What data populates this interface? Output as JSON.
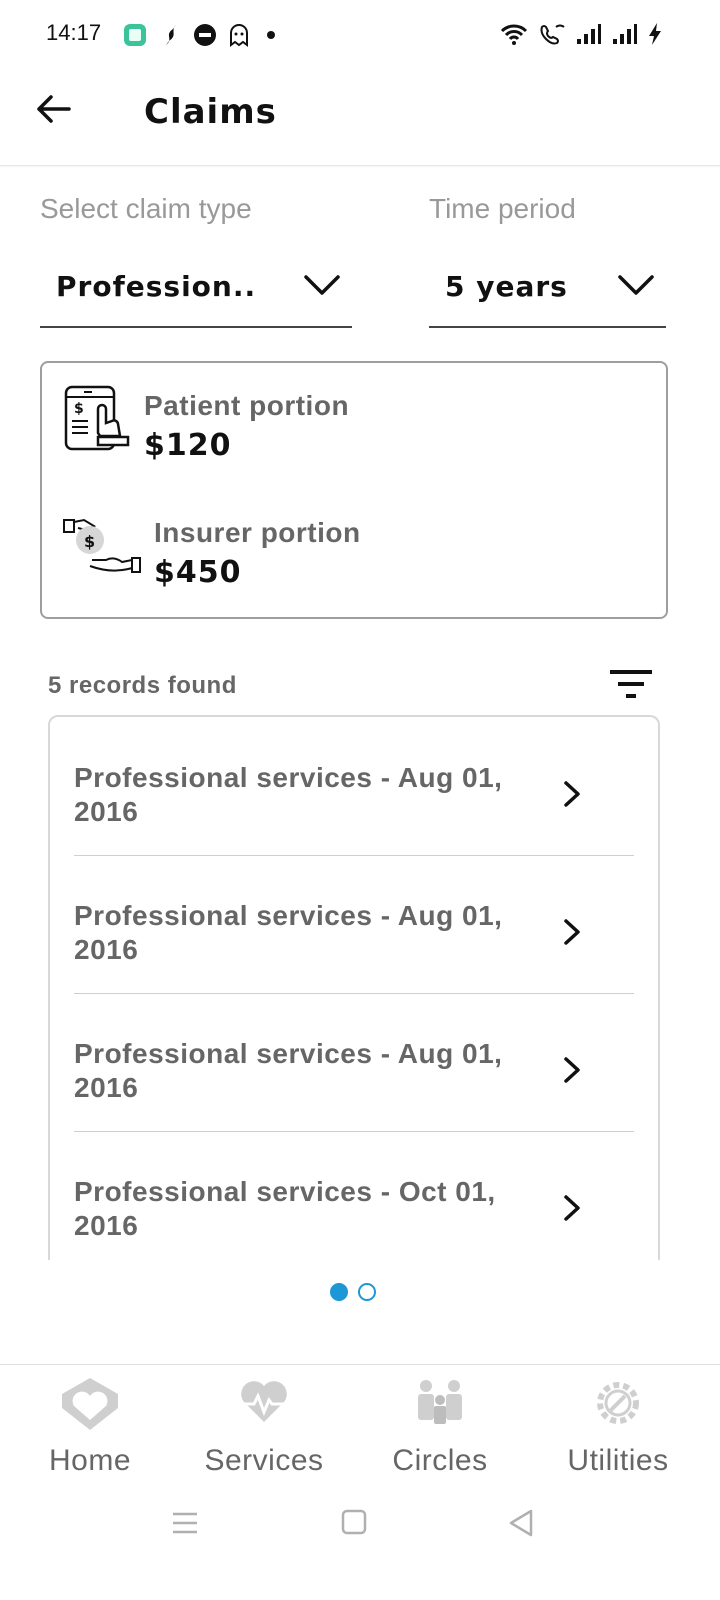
{
  "status_bar": {
    "time": "14:17"
  },
  "header": {
    "title": "Claims"
  },
  "filters": {
    "claim_type_label": "Select claim type",
    "claim_type_value": "Profession..",
    "time_period_label": "Time period",
    "time_period_value": "5 years"
  },
  "summary": {
    "patient_label": "Patient portion",
    "patient_amount": "$120",
    "insurer_label": "Insurer portion",
    "insurer_amount": "$450"
  },
  "records": {
    "count_text": "5 records found",
    "items": [
      {
        "title": "Professional services - Aug 01, 2016"
      },
      {
        "title": "Professional services - Aug 01, 2016"
      },
      {
        "title": "Professional services - Aug 01, 2016"
      },
      {
        "title": "Professional services - Oct 01, 2016"
      }
    ]
  },
  "pager": {
    "current": 1,
    "total": 2
  },
  "bottom_nav": {
    "items": [
      {
        "label": "Home",
        "icon": "home-heart-icon"
      },
      {
        "label": "Services",
        "icon": "heartbeat-icon"
      },
      {
        "label": "Circles",
        "icon": "people-icon"
      },
      {
        "label": "Utilities",
        "icon": "gear-wrench-icon"
      }
    ]
  },
  "colors": {
    "accent": "#1c98d6",
    "text_secondary": "#666666",
    "nav_icon": "#c8c8c8"
  }
}
